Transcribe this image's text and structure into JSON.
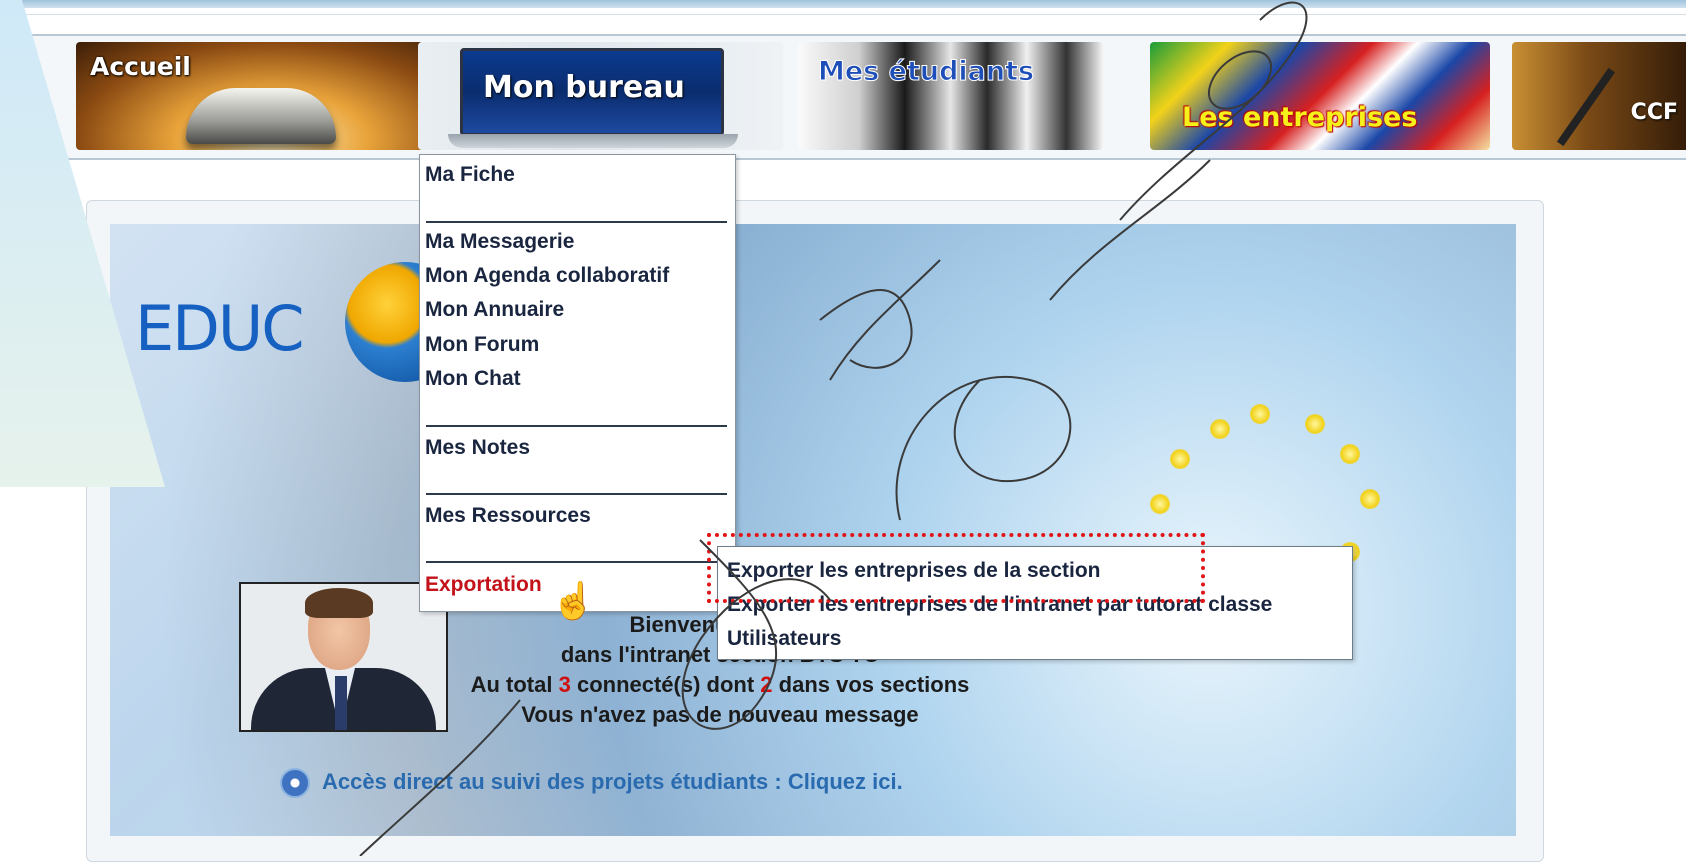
{
  "nav": {
    "accueil": "Accueil",
    "bureau": "Mon bureau",
    "etudiants": "Mes étudiants",
    "entreprises": "Les entreprises",
    "ccf": "CCF"
  },
  "logo": "EDUC",
  "menu": {
    "items": [
      "Ma Fiche",
      "Ma Messagerie",
      "Mon Agenda collaboratif",
      "Mon Annuaire",
      "Mon Forum",
      "Mon Chat",
      "Mes Notes",
      "Mes Ressources",
      "Exportation"
    ]
  },
  "submenu": {
    "items": [
      "Exporter les entreprises de la section",
      "Exporter les entreprises de l'intranet par tutorat classe",
      "Utilisateurs"
    ]
  },
  "welcome": {
    "line1": "Bienvenue , vous",
    "line2": "dans l'intranet section BTS TC",
    "line3_prefix": "Au total ",
    "line3_total": "3",
    "line3_mid": " connecté(s) dont ",
    "line3_sections": "2",
    "line3_suffix": " dans vos sections",
    "line4": "Vous n'avez pas de nouveau message"
  },
  "quick_link": "Accès direct au suivi des projets étudiants : Cliquez ici.",
  "colors": {
    "menu_text": "#1a2640",
    "active": "#c4121a",
    "highlight": "#e01515",
    "link": "#2a6bb0"
  }
}
